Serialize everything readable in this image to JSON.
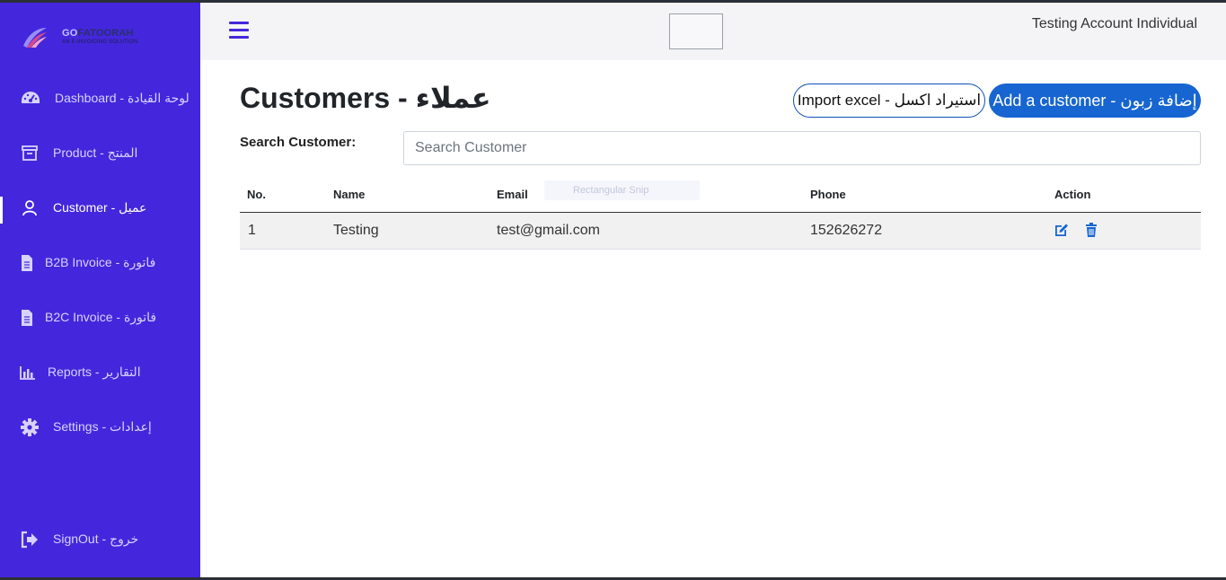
{
  "brand": {
    "title_prefix": "GO",
    "title_rest": "FATOORAH",
    "subtitle": "AN E-INVOICING SOLUTION"
  },
  "sidebar": {
    "items": [
      {
        "label": "Dashboard - لوحة القيادة",
        "icon": "dashboard-gauge-icon",
        "active": false
      },
      {
        "label": "Product - المنتج",
        "icon": "archive-box-icon",
        "active": false
      },
      {
        "label": "Customer - عميل",
        "icon": "user-icon",
        "active": true
      },
      {
        "label": "B2B Invoice - فاتورة",
        "icon": "document-icon",
        "active": false
      },
      {
        "label": "B2C Invoice - فاتورة",
        "icon": "document-icon",
        "active": false
      },
      {
        "label": "Reports - التقارير",
        "icon": "bar-chart-icon",
        "active": false
      },
      {
        "label": "Settings - إعدادات",
        "icon": "gear-icon",
        "active": false
      }
    ],
    "signout": {
      "label": "SignOut - خروج",
      "icon": "sign-out-icon"
    }
  },
  "topbar": {
    "menu_icon": "hamburger-menu-icon",
    "account_name": "Testing Account Individual"
  },
  "main": {
    "title": "Customers - عملاء",
    "import_button": "Import excel - استيراد اكسل",
    "add_button": "Add a customer - إضافة زبون",
    "search_label": "Search Customer:",
    "search_placeholder": "Search Customer",
    "search_value": "",
    "ghost_text": "Rectangular Snip"
  },
  "table": {
    "columns": [
      "No.",
      "Name",
      "Email",
      "Phone",
      "Action"
    ],
    "rows": [
      {
        "no": "1",
        "name": "Testing",
        "email": "test@gmail.com",
        "phone": "152626272",
        "actions": [
          "edit-icon",
          "trash-icon"
        ]
      }
    ]
  },
  "colors": {
    "sidebar_bg": "#4427dc",
    "primary_button": "#1765d1",
    "accent_icon": "#1765d1"
  }
}
